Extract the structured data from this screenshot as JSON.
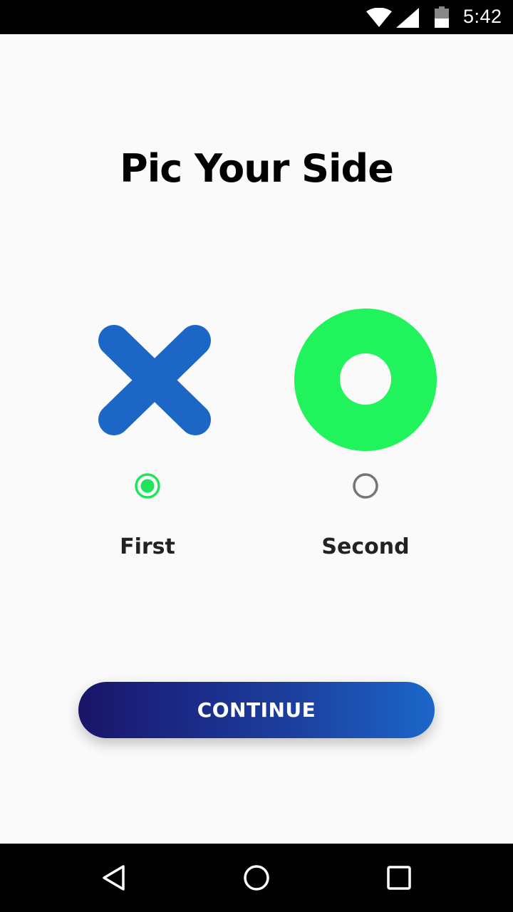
{
  "status_bar": {
    "time": "5:42",
    "icons": [
      "wifi-icon",
      "signal-icon",
      "battery-icon"
    ]
  },
  "title": "Pic Your Side",
  "options": [
    {
      "label": "First",
      "symbol": "x-mark-icon",
      "symbol_color": "#1c66c6",
      "selected": true
    },
    {
      "label": "Second",
      "symbol": "o-ring-icon",
      "symbol_color": "#20f35c",
      "selected": false
    }
  ],
  "colors": {
    "radio_selected": "#20e45c",
    "radio_unselected": "#757575",
    "button_gradient_start": "#1a1466",
    "button_gradient_end": "#1b67c9"
  },
  "continue_button": {
    "label": "CONTINUE"
  },
  "nav_bar": {
    "icons": [
      "back-icon",
      "home-icon",
      "recents-icon"
    ]
  }
}
